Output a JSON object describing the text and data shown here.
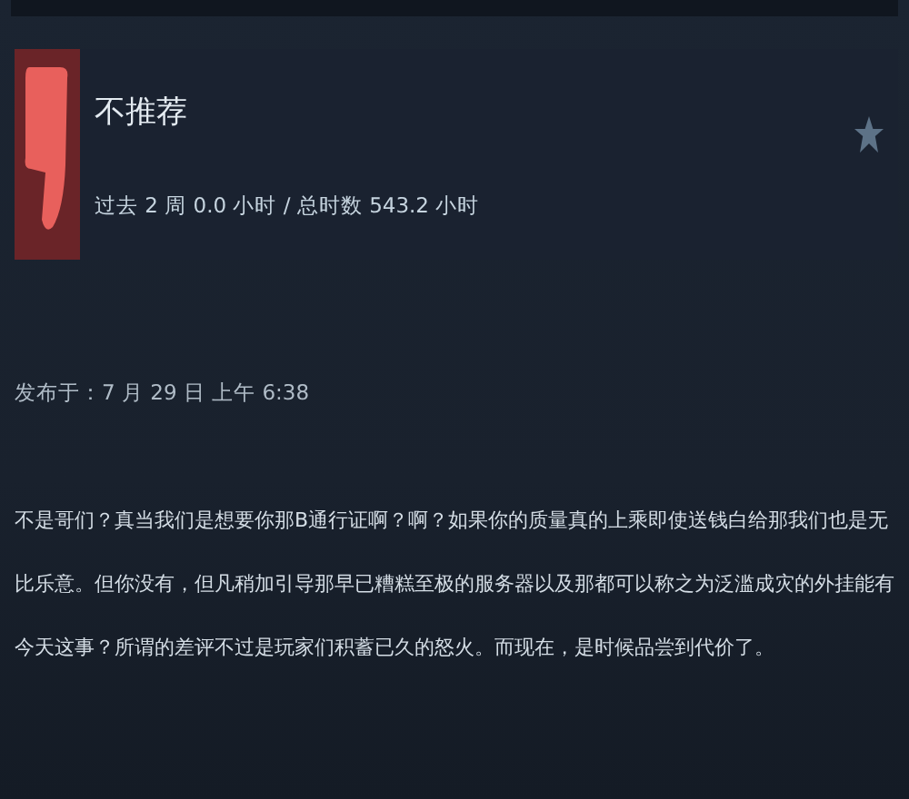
{
  "review": {
    "recommended": false,
    "title": "不推荐",
    "playtime": "过去 2 周 0.0 小时 / 总时数 543.2 小时",
    "posted": "发布于：7 月 29 日 上午 6:38",
    "body": "不是哥们？真当我们是想要你那B通行证啊？啊？如果你的质量真的上乘即使送钱白给那我们也是无比乐意。但你没有，但凡稍加引导那早已糟糕至极的服务器以及那都可以称之为泛滥成灾的外挂能有今天这事？所谓的差评不过是玩家们积蓄已久的怒火。而现在，是时候品尝到代价了。"
  }
}
